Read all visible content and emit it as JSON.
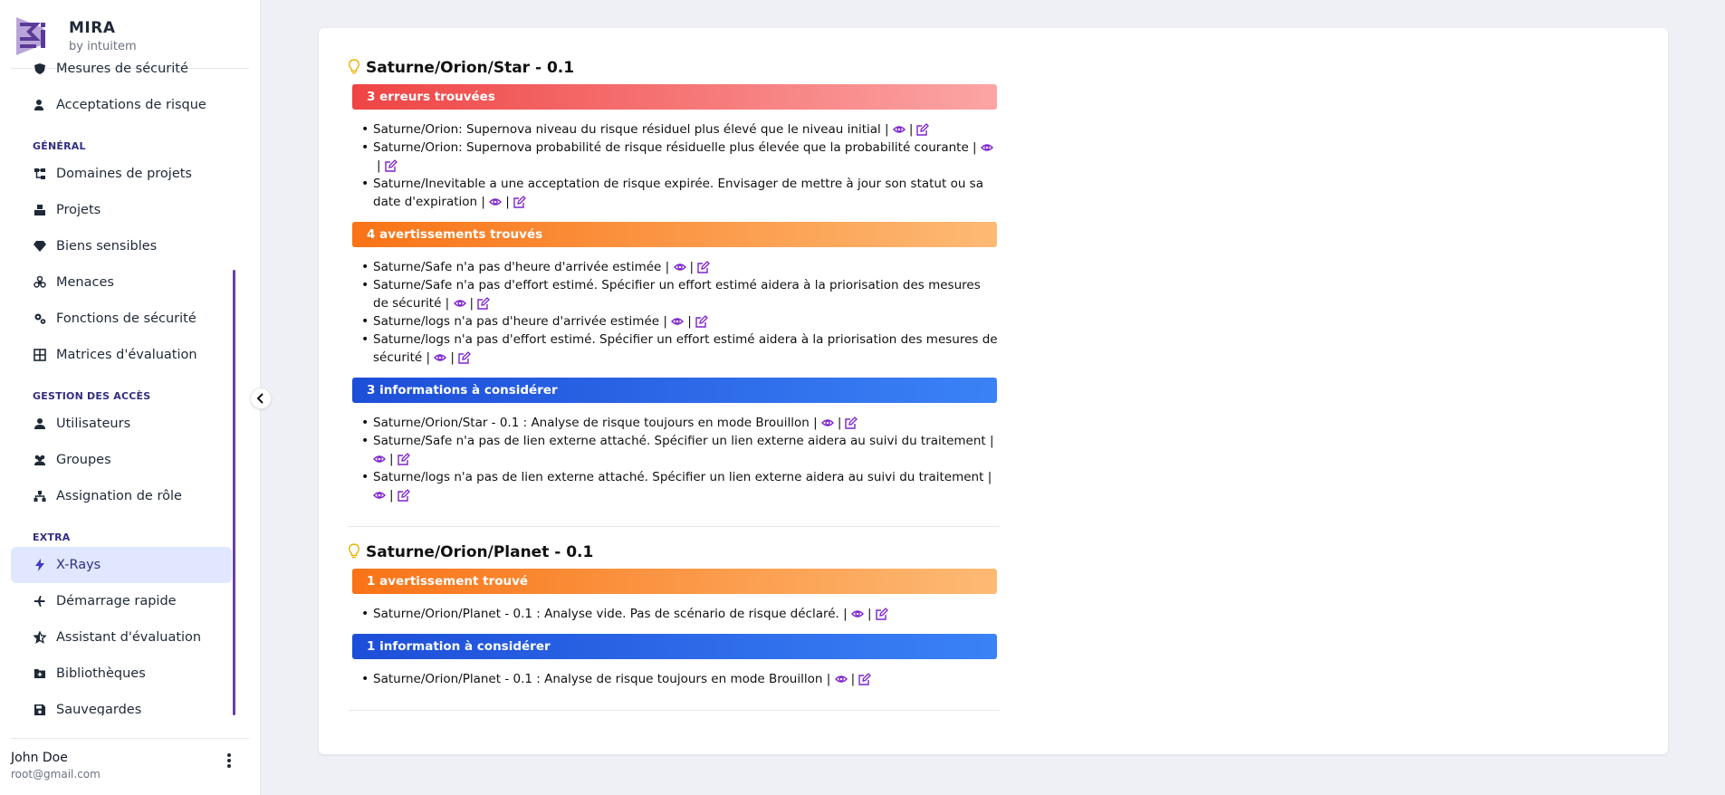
{
  "brand": {
    "title": "MIRA",
    "subtitle": "by intuitem"
  },
  "sidebar": {
    "top_items": [
      {
        "label": "Mesures de sécurité",
        "icon": "shield-icon"
      },
      {
        "label": "Acceptations de risque",
        "icon": "user-check-icon"
      }
    ],
    "sections": [
      {
        "title": "GÉNÉRAL",
        "items": [
          {
            "label": "Domaines de projets",
            "icon": "sitemap-icon"
          },
          {
            "label": "Projets",
            "icon": "cubes-icon"
          },
          {
            "label": "Biens sensibles",
            "icon": "gem-icon"
          },
          {
            "label": "Menaces",
            "icon": "biohazard-icon"
          },
          {
            "label": "Fonctions de sécurité",
            "icon": "gears-icon"
          },
          {
            "label": "Matrices d'évaluation",
            "icon": "table-cells-icon"
          }
        ]
      },
      {
        "title": "GESTION DES ACCÈS",
        "items": [
          {
            "label": "Utilisateurs",
            "icon": "user-icon"
          },
          {
            "label": "Groupes",
            "icon": "users-icon"
          },
          {
            "label": "Assignation de rôle",
            "icon": "hierarchy-icon"
          }
        ]
      },
      {
        "title": "EXTRA",
        "items": [
          {
            "label": "X-Rays",
            "icon": "bolt-icon",
            "active": true
          },
          {
            "label": "Démarrage rapide",
            "icon": "plane-icon"
          },
          {
            "label": "Assistant d'évaluation",
            "icon": "star-half-icon"
          },
          {
            "label": "Bibliothèques",
            "icon": "folder-plus-icon"
          },
          {
            "label": "Sauvegardes",
            "icon": "save-icon"
          }
        ]
      }
    ]
  },
  "user": {
    "name": "John Doe",
    "email": "root@gmail.com"
  },
  "blocks": [
    {
      "title": "Saturne/Orion/Star - 0.1",
      "groups": [
        {
          "kind": "red",
          "label": "3 erreurs trouvées",
          "messages": [
            "Saturne/Orion: Supernova niveau du risque résiduel plus élevé que le niveau initial |",
            "Saturne/Orion: Supernova probabilité de risque résiduelle plus élevée que la probabilité courante |",
            "Saturne/Inevitable a une acceptation de risque expirée. Envisager de mettre à jour son statut ou sa date d'expiration |"
          ]
        },
        {
          "kind": "orange",
          "label": "4 avertissements trouvés",
          "messages": [
            "Saturne/Safe n'a pas d'heure d'arrivée estimée |",
            "Saturne/Safe n'a pas d'effort estimé. Spécifier un effort estimé aidera à la priorisation des mesures de sécurité |",
            "Saturne/logs n'a pas d'heure d'arrivée estimée |",
            "Saturne/logs n'a pas d'effort estimé. Spécifier un effort estimé aidera à la priorisation des mesures de sécurité |"
          ]
        },
        {
          "kind": "blue",
          "label": "3 informations à considérer",
          "messages": [
            "Saturne/Orion/Star - 0.1 : Analyse de risque toujours en mode Brouillon |",
            "Saturne/Safe n'a pas de lien externe attaché. Spécifier un lien externe aidera au suivi du traitement |",
            "Saturne/logs n'a pas de lien externe attaché. Spécifier un lien externe aidera au suivi du traitement |"
          ]
        }
      ]
    },
    {
      "title": "Saturne/Orion/Planet - 0.1",
      "groups": [
        {
          "kind": "orange",
          "label": "1 avertissement trouvé",
          "messages": [
            "Saturne/Orion/Planet - 0.1 : Analyse vide. Pas de scénario de risque déclaré. |"
          ]
        },
        {
          "kind": "blue",
          "label": "1 information à considérer",
          "messages": [
            "Saturne/Orion/Planet - 0.1 : Analyse de risque toujours en mode Brouillon |"
          ]
        }
      ]
    }
  ],
  "colors": {
    "accent": "#6b3fa0",
    "link_icon": "#7e22ce",
    "bulb": "#eab308"
  }
}
